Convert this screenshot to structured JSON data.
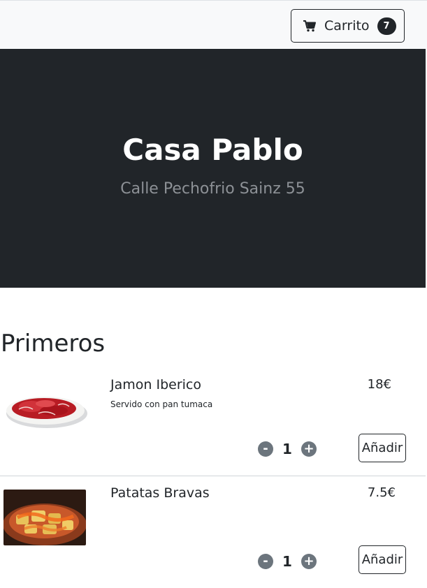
{
  "navbar": {
    "cart_label": "Carrito",
    "cart_count": "7",
    "cart_icon": "shopping-cart-icon"
  },
  "hero": {
    "title": "Casa Pablo",
    "subtitle": "Calle Pechofrio Sainz 55"
  },
  "section": {
    "title": "Primeros"
  },
  "items": [
    {
      "name": "Jamon Iberico",
      "description": "Servido con pan tumaca",
      "price": "18€",
      "quantity": "1",
      "minus_label": "-",
      "plus_label": "+",
      "add_label": "Añadir"
    },
    {
      "name": "Patatas Bravas",
      "description": "",
      "price": "7.5€",
      "quantity": "1",
      "minus_label": "-",
      "plus_label": "+",
      "add_label": "Añadir"
    }
  ],
  "colors": {
    "hero_bg": "#212529",
    "navbar_bg": "#f8f9fa",
    "qty_button": "#6c757d",
    "subtitle": "#8d9196"
  }
}
